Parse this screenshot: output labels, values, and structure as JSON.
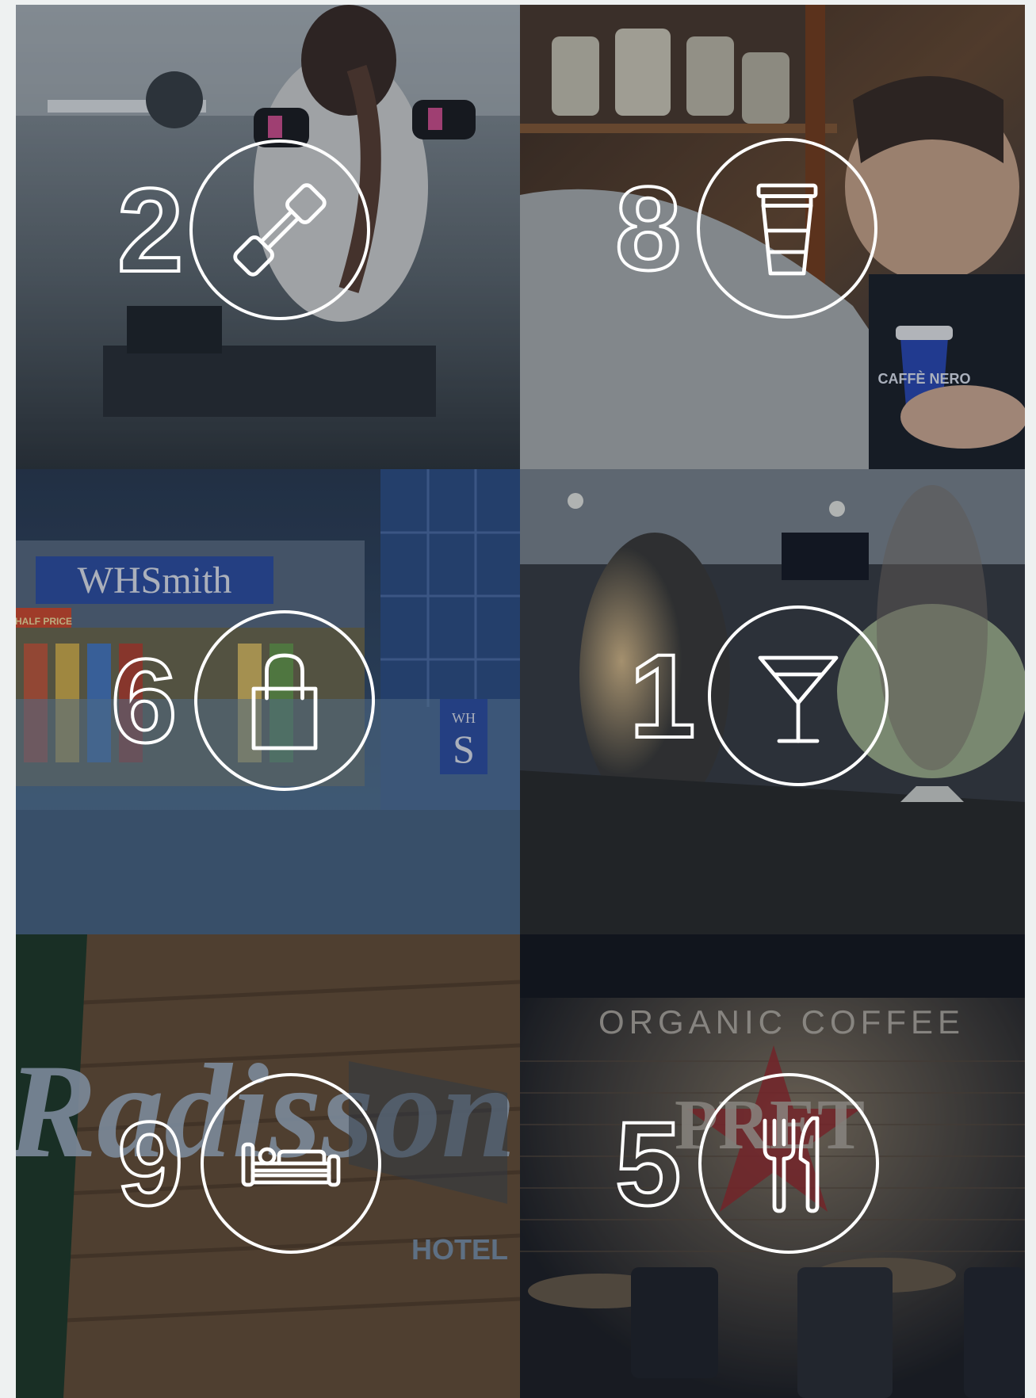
{
  "tiles": [
    {
      "id": "gym",
      "count": "2",
      "icon": "dumbbell-icon",
      "scene": "gym-workout-photo"
    },
    {
      "id": "coffee",
      "count": "8",
      "icon": "coffee-cup-icon",
      "scene": "caffe-nero-barista-photo",
      "sign_text": "CAFFÈ NERO"
    },
    {
      "id": "shops",
      "count": "6",
      "icon": "shopping-bag-icon",
      "scene": "whsmith-store-photo",
      "sign_text": "WHSmith",
      "sign_text_2": "HALF PRICE"
    },
    {
      "id": "bars",
      "count": "1",
      "icon": "cocktail-icon",
      "scene": "bar-counter-photo"
    },
    {
      "id": "hotels",
      "count": "9",
      "icon": "bed-icon",
      "scene": "radisson-hotel-sign-photo",
      "sign_text": "Radisson",
      "sign_text_2": "HOTEL"
    },
    {
      "id": "restaurants",
      "count": "5",
      "icon": "fork-knife-icon",
      "scene": "pret-cafe-photo",
      "sign_text": "ORGANIC COFFEE",
      "sign_text_2": "PRET"
    }
  ],
  "colors": {
    "ring": "#ffffff",
    "overlay": "rgba(10,22,40,0.28)",
    "page_background": "#eef1f1"
  }
}
